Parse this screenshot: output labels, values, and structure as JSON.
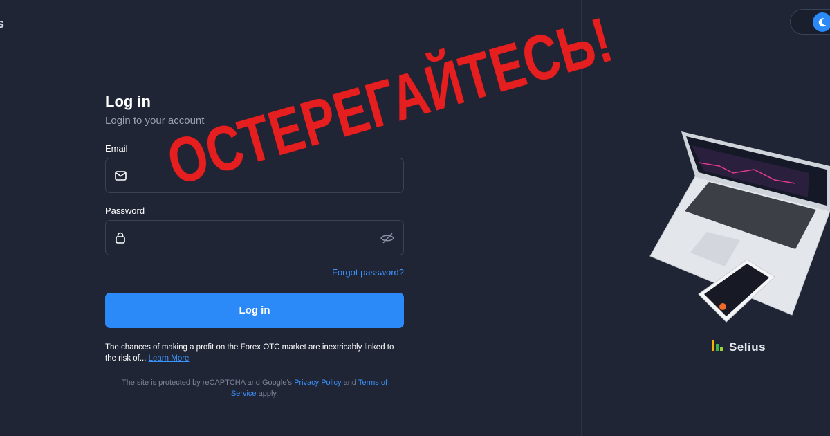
{
  "corner_mark": "s",
  "form": {
    "title": "Log in",
    "subtitle": "Login to your account",
    "email_label": "Email",
    "email_value": "",
    "password_label": "Password",
    "password_value": "",
    "forgot_label": "Forgot password?",
    "login_button": "Log in"
  },
  "disclaimer": {
    "text": "The chances of making a profit on the Forex OTC market are inextricably linked to the risk of...",
    "link": "Learn More"
  },
  "recaptcha": {
    "prefix": "The site is protected by reCAPTCHA and Google's",
    "privacy": "Privacy Policy",
    "and": "and",
    "terms": "Terms of Service",
    "suffix": "apply."
  },
  "overlay_warning": "ОСТЕРЕГАЙТЕСЬ!",
  "brand": {
    "name": "Selius"
  },
  "icons": [
    "mail-icon",
    "lock-icon",
    "eye-off-icon",
    "moon-icon",
    "selius-logo"
  ],
  "colors": {
    "background": "#1f2535",
    "accent": "#2b8af7",
    "warning": "#e51f1f"
  }
}
